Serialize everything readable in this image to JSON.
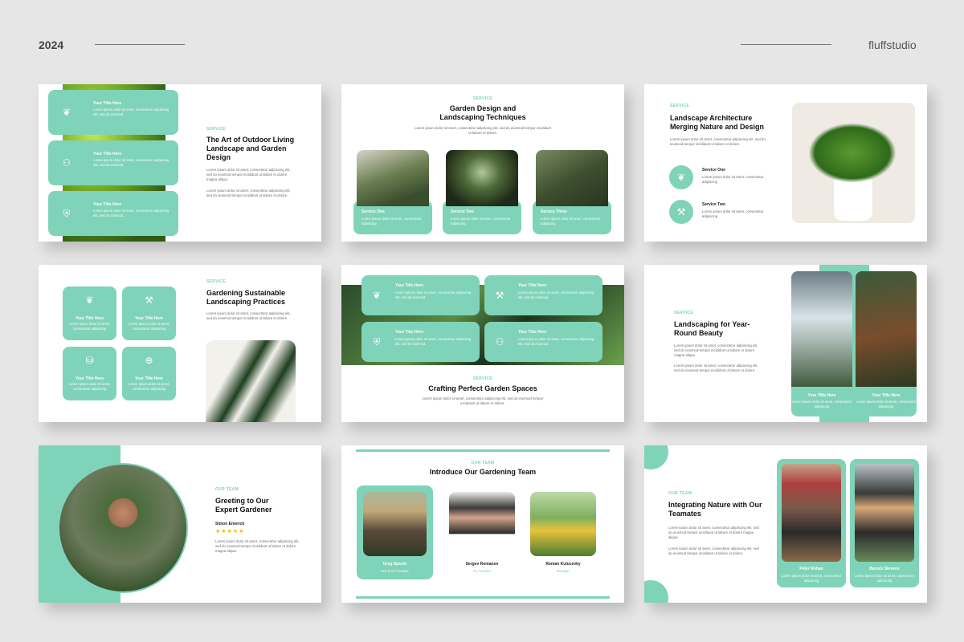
{
  "header": {
    "year": "2024",
    "brand": "fluffstudio"
  },
  "common": {
    "service_tag": "SERVICE",
    "team_tag": "OUR TEAM",
    "card_title": "Your Title Here",
    "lorem_long": "Lorem ipsum dolor sit amet, consectetur adipiscing elit, sed do eiusmod tempor incididunt ut labore et dolore magna aliqua.",
    "lorem_mid": "Lorem ipsum dolor sit amet, consectetur adipiscing elit, sed do eiusmod tempor incididunt ut labore et dolore.",
    "lorem_card": "Lorem ipsum dolor sit amet, consectetur adipiscing elit, sed do eiusmod.",
    "lorem_short": "Lorem ipsum dolor sit amet, consectetur adipiscing",
    "lorem_tiny": "Lorem ipsum dolor sit amet, consectetur adipiscing",
    "ut_enim": "Ut enim ad minim veniam."
  },
  "slide1": {
    "title": "The Art of Outdoor Living Landscape and Garden Design",
    "icons": [
      "sprout-icon",
      "users-icon",
      "shield-icon"
    ]
  },
  "slide2": {
    "title": "Garden Design and Landscaping Techniques",
    "services": [
      "Service One",
      "Service Two",
      "Service Three"
    ]
  },
  "slide3": {
    "title": "Landscape Architecture Merging Nature and Design",
    "services": [
      "Service One",
      "Service Two"
    ]
  },
  "slide4": {
    "title": "Gardening Sustainable Landscaping Practices"
  },
  "slide5": {
    "title": "Crafting Perfect Garden Spaces"
  },
  "slide6": {
    "title": "Landscaping for Year-Round Beauty"
  },
  "slide7": {
    "title": "Greeting to Our Expert Gardener",
    "name": "Simon Emerick",
    "stars": "★★★★★"
  },
  "slide8": {
    "title": "Introduce Our Gardening Team",
    "members": [
      {
        "name": "Greg Spesio",
        "role": "Ceo & Co Founder"
      },
      {
        "name": "Sergev Romanov",
        "role": "Co Founder"
      },
      {
        "name": "Roman Kulucevky",
        "role": "Manager"
      }
    ]
  },
  "slide9": {
    "title": "Integrating Nature with Our Teamates",
    "members": [
      {
        "name": "Peter Rohan"
      },
      {
        "name": "Barock Stevens"
      }
    ]
  }
}
